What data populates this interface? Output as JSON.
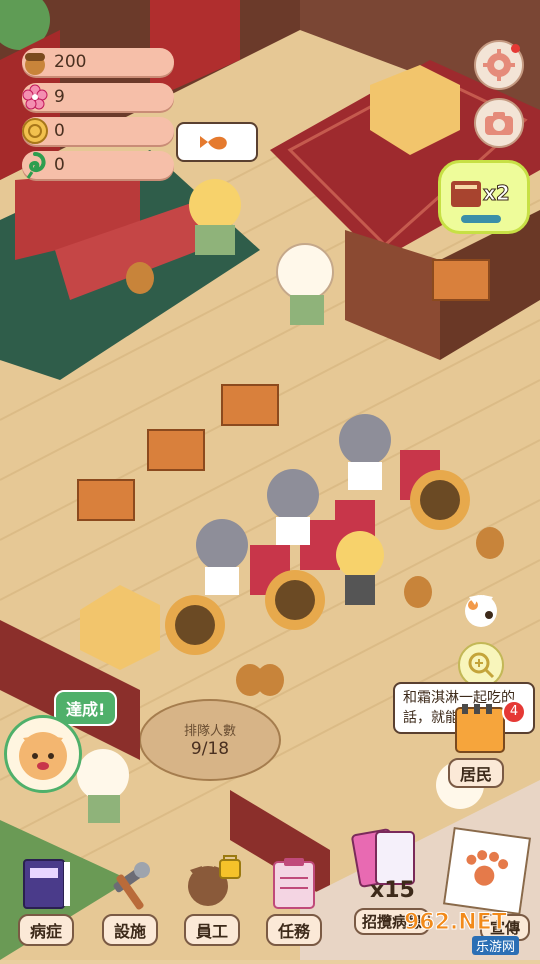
{
  "resources": [
    {
      "name": "acorn",
      "icon": "acorn-icon",
      "value": "200"
    },
    {
      "name": "sakura",
      "icon": "sakura-icon",
      "value": "9"
    },
    {
      "name": "coin",
      "icon": "coin-icon",
      "value": "0"
    },
    {
      "name": "leaf",
      "icon": "leaf-spiral-icon",
      "value": "0"
    }
  ],
  "top_right": {
    "settings_icon": "gear-icon",
    "camera_icon": "camera-icon",
    "boost_label": "x2"
  },
  "queue": {
    "title": "排隊人數",
    "count": "9/18"
  },
  "achievement_label": "達成!",
  "resident": {
    "speech": "和霜淇淋一起吃的話，就能",
    "label": "居民",
    "badge": "4"
  },
  "recruit": {
    "multiplier": "x15",
    "label": "招攬病患"
  },
  "promo_label": "宣傳",
  "bottom_nav": [
    {
      "key": "illness",
      "label": "病症",
      "icon": "book-icon"
    },
    {
      "key": "facility",
      "label": "設施",
      "icon": "hammer-wrench-icon"
    },
    {
      "key": "staff",
      "label": "員工",
      "icon": "cat-staff-icon",
      "locked": true
    },
    {
      "key": "task",
      "label": "任務",
      "icon": "clipboard-icon"
    }
  ],
  "watermark": {
    "brand": "962.NET",
    "sub": "乐游网"
  },
  "colors": {
    "floor": "#e8c892",
    "wall": "#8a2b2b",
    "rug": "#9e2a2e",
    "accent": "#f6bfa9"
  }
}
